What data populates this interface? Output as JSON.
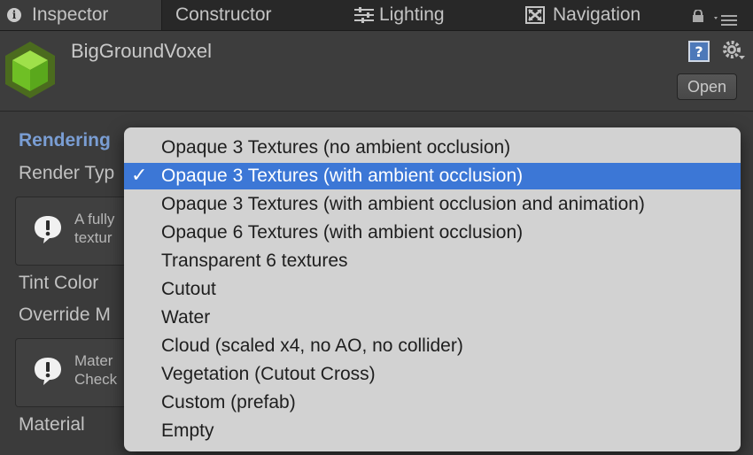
{
  "tabs": [
    {
      "label": "Inspector",
      "icon": "info-icon",
      "active": true
    },
    {
      "label": "Constructor",
      "icon": null,
      "active": false
    },
    {
      "label": "Lighting",
      "icon": "sliders-icon",
      "active": false
    },
    {
      "label": "Navigation",
      "icon": "navigation-icon",
      "active": false
    }
  ],
  "header": {
    "object_name": "BigGroundVoxel",
    "open_button": "Open",
    "icon": "cube-icon"
  },
  "inspector": {
    "section_title": "Rendering",
    "render_type_label": "Render Typ",
    "helpbox1_text": "A fully\ntextur",
    "tint_color_label": "Tint Color",
    "override_label": "Override M",
    "helpbox2_text": "Mater\nCheck",
    "material_label": "Material"
  },
  "dropdown": {
    "selected_index": 1,
    "options": [
      "Opaque 3 Textures (no ambient occlusion)",
      "Opaque 3 Textures (with ambient occlusion)",
      "Opaque 3 Textures (with ambient occlusion and animation)",
      "Opaque 6 Textures (with ambient occlusion)",
      "Transparent 6 textures",
      "Cutout",
      "Water",
      "Cloud (scaled x4, no AO, no collider)",
      "Vegetation (Cutout Cross)",
      "Custom (prefab)",
      "Empty"
    ],
    "checkmark": "✓"
  },
  "colors": {
    "selection": "#3c77d6",
    "section_title": "#7a9ed4",
    "cube_green": "#7ed321"
  }
}
